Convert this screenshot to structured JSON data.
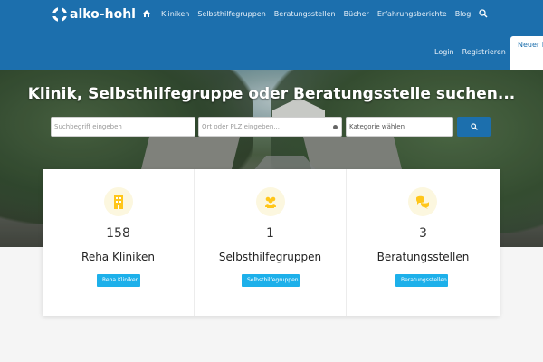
{
  "header": {
    "logo": "alko-hohl",
    "nav": [
      "Kliniken",
      "Selbsthilfegruppen",
      "Beratungsstellen",
      "Bücher",
      "Erfahrungsberichte",
      "Blog"
    ],
    "login": "Login",
    "register": "Registrieren",
    "new_entry": "Neuer E"
  },
  "hero": {
    "title": "Klinik, Selbsthilfegruppe oder Beratungsstelle suchen...",
    "search_placeholder": "Suchbegriff eingeben",
    "location_placeholder": "Ort oder PLZ eingeben...",
    "category": "Kategorie wählen"
  },
  "cards": [
    {
      "count": "158",
      "title": "Reha Kliniken",
      "button": "Reha Kliniken",
      "icon": "building-icon"
    },
    {
      "count": "1",
      "title": "Selbsthilfegruppen",
      "button": "Selbsthilfegruppen",
      "icon": "group-icon"
    },
    {
      "count": "3",
      "title": "Beratungsstellen",
      "button": "Beratungsstellen",
      "icon": "chat-icon"
    }
  ],
  "colors": {
    "brand": "#1c6fad",
    "button": "#1db0ea",
    "icon_background": "#fcf7df",
    "icon": "#ffc61a"
  }
}
